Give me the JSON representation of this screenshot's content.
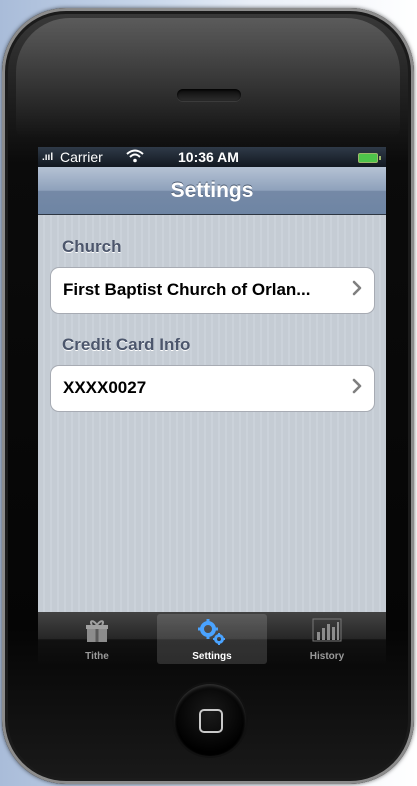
{
  "status_bar": {
    "signal": ".ııl",
    "carrier": "Carrier",
    "wifi_icon": "wifi-icon",
    "time": "10:36 AM",
    "battery_icon": "battery-icon"
  },
  "nav": {
    "title": "Settings"
  },
  "sections": [
    {
      "header": "Church",
      "cell_label": "First Baptist Church of Orlan...",
      "accessory": "chevron-right-icon"
    },
    {
      "header": "Credit Card Info",
      "cell_label": "XXXX0027",
      "accessory": "chevron-right-icon"
    }
  ],
  "tabbar": {
    "tabs": [
      {
        "label": "Tithe",
        "icon": "gift-icon",
        "selected": false
      },
      {
        "label": "Settings",
        "icon": "gears-icon",
        "selected": true
      },
      {
        "label": "History",
        "icon": "bar-chart-icon",
        "selected": false
      }
    ]
  },
  "colors": {
    "accent": "#4aa3ff",
    "nav_bar": "#7589a6",
    "table_bg": "#c5ccd4",
    "section_text": "#4c566c"
  }
}
